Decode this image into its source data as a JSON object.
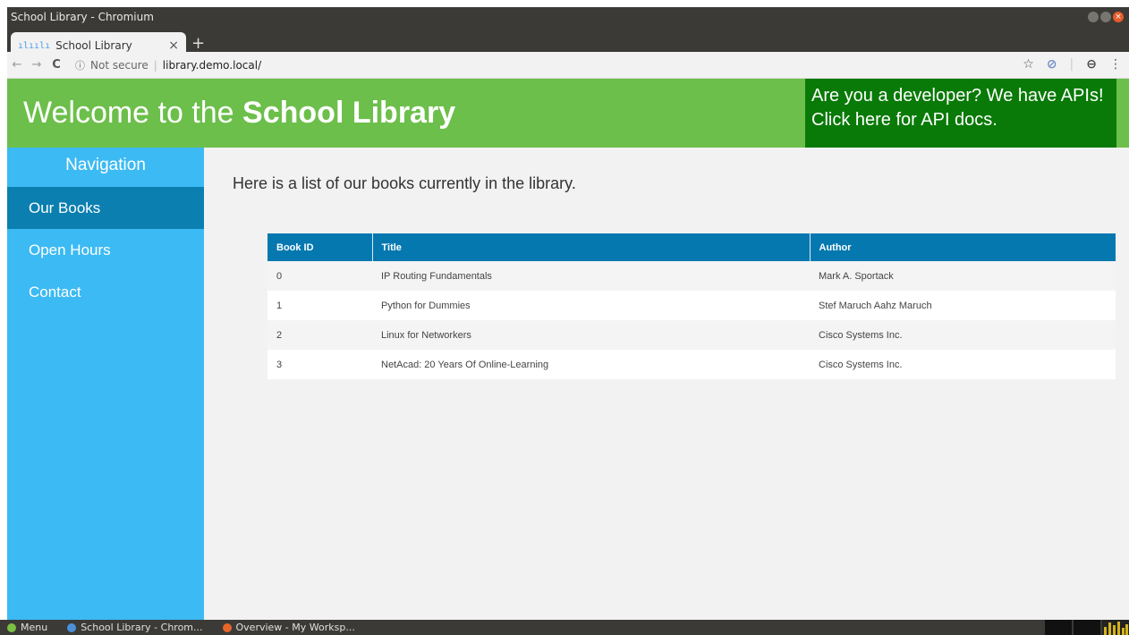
{
  "window": {
    "title": "School Library - Chromium"
  },
  "browser": {
    "tab": {
      "favicon_text": "ılıılı",
      "title": "School Library",
      "close_glyph": "×"
    },
    "new_tab_glyph": "+",
    "back_glyph": "←",
    "forward_glyph": "→",
    "reload_glyph": "C",
    "info_glyph": "ⓘ",
    "security_label": "Not secure",
    "separator": "|",
    "url": "library.demo.local/",
    "star_glyph": "☆",
    "extension_glyph": "⊘",
    "separator2": "|",
    "profile_glyph": "⊖",
    "menu_glyph": "⋮"
  },
  "header": {
    "title_prefix": "Welcome to the",
    "title_bold": "School Library",
    "api_line1": "Are you a developer? We have APIs!",
    "api_line2": "Click here for API docs."
  },
  "sidebar": {
    "heading": "Navigation",
    "items": [
      {
        "label": "Our Books",
        "active": true
      },
      {
        "label": "Open Hours",
        "active": false
      },
      {
        "label": "Contact",
        "active": false
      }
    ]
  },
  "main": {
    "intro": "Here is a list of our books currently in the library.",
    "table": {
      "headers": [
        "Book ID",
        "Title",
        "Author"
      ],
      "rows": [
        [
          "0",
          "IP Routing Fundamentals",
          "Mark A. Sportack"
        ],
        [
          "1",
          "Python for Dummies",
          "Stef Maruch Aahz Maruch"
        ],
        [
          "2",
          "Linux for Networkers",
          "Cisco Systems Inc."
        ],
        [
          "3",
          "NetAcad: 20 Years Of Online-Learning",
          "Cisco Systems Inc."
        ]
      ]
    }
  },
  "taskbar": {
    "menu_label": "Menu",
    "items": [
      "School Library - Chrom...",
      "Overview - My Worksp..."
    ]
  },
  "colors": {
    "header_green": "#6cbf4a",
    "api_box_green": "#097a07",
    "sidebar_blue": "#3cbaf3",
    "sidebar_active": "#0b7fb0",
    "table_header": "#0578b0"
  }
}
